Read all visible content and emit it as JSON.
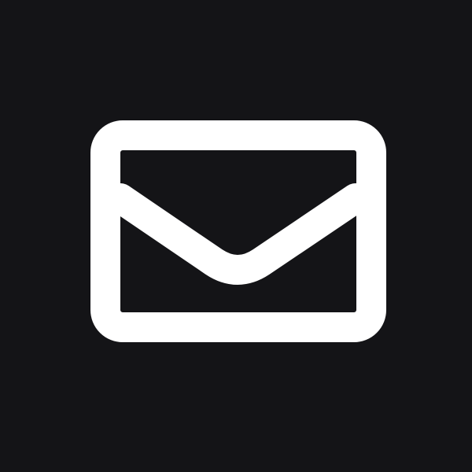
{
  "icon": {
    "name": "mail-icon",
    "glyph": "envelope"
  },
  "colors": {
    "background": "#141417",
    "foreground": "#FFFFFF"
  }
}
